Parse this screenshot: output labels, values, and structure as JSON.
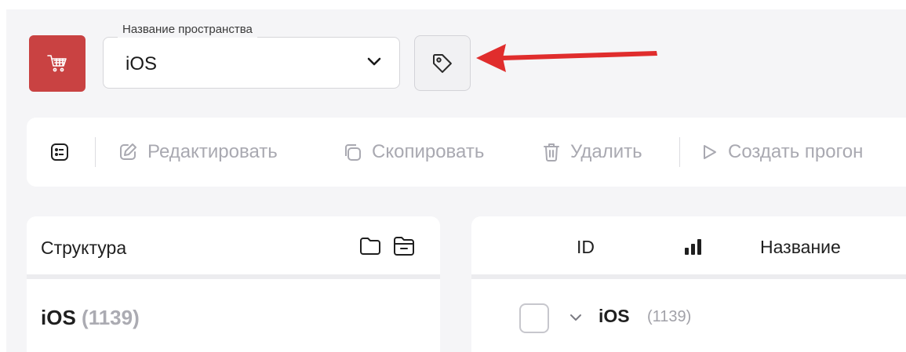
{
  "header": {
    "space_select": {
      "legend": "Название пространства",
      "value": "iOS"
    }
  },
  "toolbar": {
    "edit_label": "Редактировать",
    "copy_label": "Скопировать",
    "delete_label": "Удалить",
    "run_label": "Создать прогон"
  },
  "structure": {
    "title": "Структура",
    "root": {
      "name": "iOS",
      "count": "(1139)"
    }
  },
  "table": {
    "columns": {
      "id": "ID",
      "name": "Название"
    },
    "rows": [
      {
        "name": "iOS",
        "count": "(1139)"
      }
    ]
  },
  "colors": {
    "brand": "#c94242",
    "arrow": "#e02d2d",
    "disabled_text": "#a9a9b1",
    "background": "#f5f5f7"
  },
  "icons": [
    "cart-icon",
    "chevron-down-icon",
    "tag-icon",
    "list-view-icon",
    "edit-icon",
    "copy-icon",
    "trash-icon",
    "play-icon",
    "folder-icon",
    "folder-collapse-icon",
    "priority-bars-icon",
    "caret-down-icon"
  ]
}
